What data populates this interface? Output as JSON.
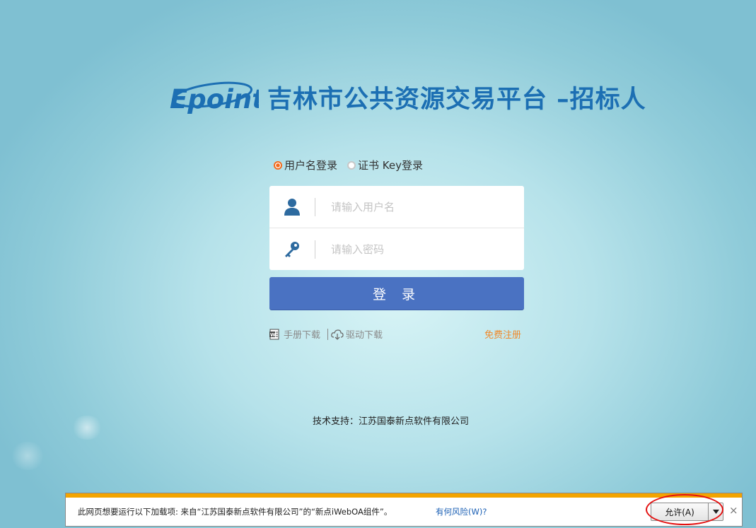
{
  "header": {
    "logo_text": "Epoint",
    "title": "吉林市公共资源交易平台 –招标人"
  },
  "login_mode": {
    "options": [
      {
        "label": "用户名登录",
        "selected": true
      },
      {
        "label": "证书 Key登录",
        "selected": false
      }
    ]
  },
  "form": {
    "username_placeholder": "请输入用户名",
    "password_placeholder": "请输入密码",
    "login_label": "登 录"
  },
  "links": {
    "manual": "手册下载",
    "driver": "驱动下载",
    "register": "免费注册"
  },
  "footer": {
    "support": "技术支持：江苏国泰新点软件有限公司"
  },
  "notification": {
    "message": "此网页想要运行以下加载项: 来自“江苏国泰新点软件有限公司”的“新点iWebOA组件”。",
    "risk_link": "有何风险(W)?",
    "allow_label": "允许(A)",
    "close_symbol": "×"
  },
  "colors": {
    "brand_blue": "#1c6fb3",
    "button_blue": "#4a72c2",
    "radio_orange": "#f26b1d",
    "register_orange": "#f0892b",
    "notify_strip": "#f3a400",
    "annotation_red": "#e31010"
  }
}
